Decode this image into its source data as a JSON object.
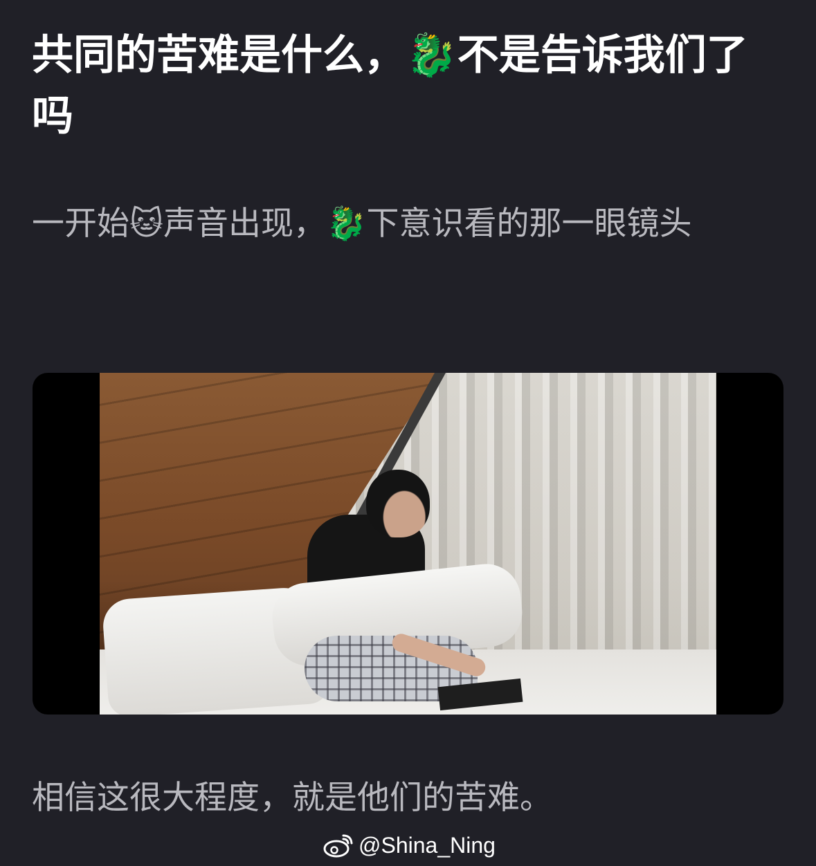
{
  "post": {
    "title": "共同的苦难是什么，🐉不是告诉我们了吗",
    "paragraph_1": "一开始🐱声音出现，🐉下意识看的那一眼镜头",
    "paragraph_2": "相信这很大程度，就是他们的苦难。"
  },
  "watermark": {
    "text": "@Shina_Ning",
    "icon": "weibo-icon"
  },
  "colors": {
    "background": "#202027",
    "title": "#ffffff",
    "body_text": "#b9b9bf",
    "video_frame": "#000000"
  }
}
